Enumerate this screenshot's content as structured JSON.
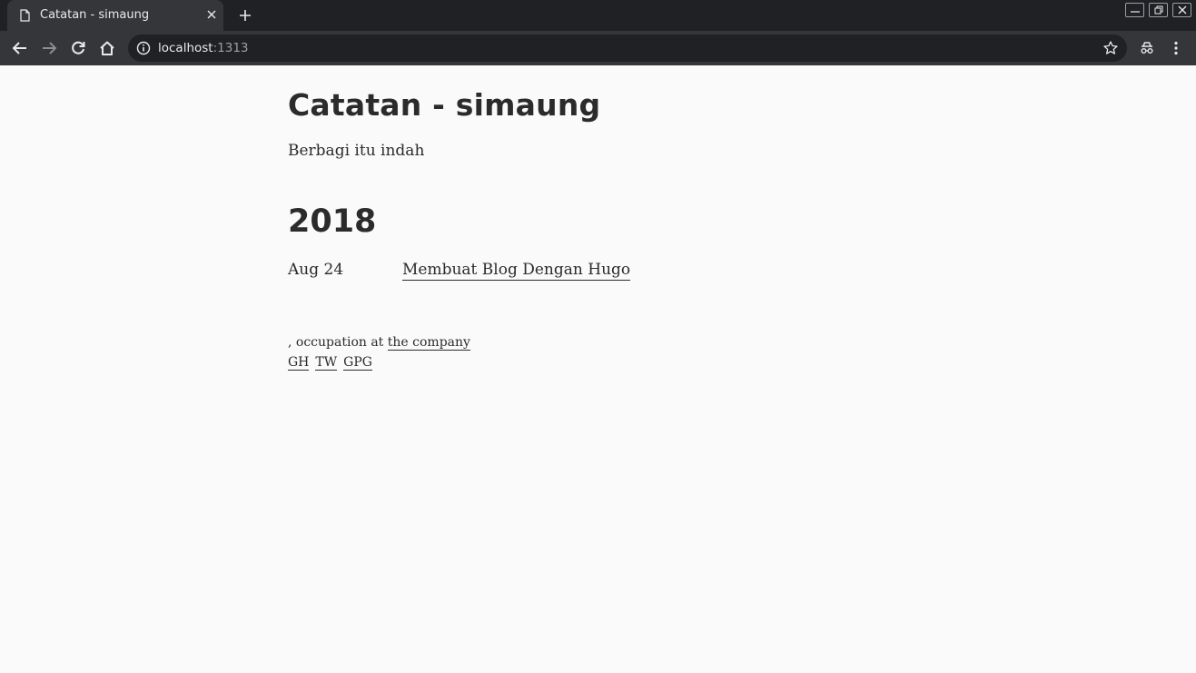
{
  "browser": {
    "tab_title": "Catatan - simaung",
    "url_host": "localhost",
    "url_port": ":1313"
  },
  "site": {
    "title": "Catatan - simaung",
    "subtitle": "Berbagi itu indah"
  },
  "archive": {
    "year": "2018",
    "posts": [
      {
        "date": "Aug 24",
        "title": "Membuat Blog Dengan Hugo"
      }
    ]
  },
  "footer": {
    "occupation_prefix": ", occupation at ",
    "company_link": "the company",
    "links": [
      "GH",
      "TW",
      "GPG"
    ]
  }
}
